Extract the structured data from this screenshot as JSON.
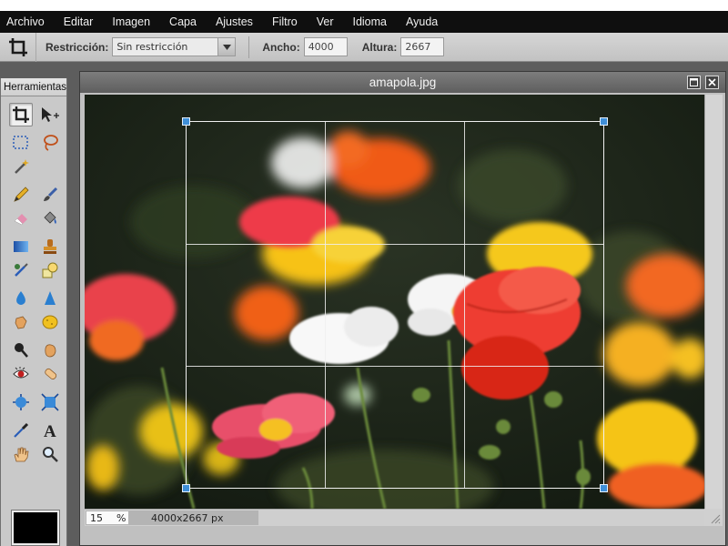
{
  "menubar": {
    "items": [
      "Archivo",
      "Editar",
      "Imagen",
      "Capa",
      "Ajustes",
      "Filtro",
      "Ver",
      "Idioma",
      "Ayuda"
    ]
  },
  "options": {
    "restriction_label": "Restricción:",
    "restriction_value": "Sin restricción",
    "width_label": "Ancho:",
    "width_value": "4000",
    "height_label": "Altura:",
    "height_value": "2667"
  },
  "tools_panel": {
    "title": "Herramientas",
    "primary_color": "#000000",
    "tools": [
      {
        "name": "crop-tool-icon",
        "active": true
      },
      {
        "name": "move-tool-icon"
      },
      {
        "name": "marquee-tool-icon"
      },
      {
        "name": "lasso-tool-icon"
      },
      {
        "name": "magic-wand-tool-icon"
      },
      {
        "name": "pencil-tool-icon"
      },
      {
        "name": "brush-tool-icon"
      },
      {
        "name": "eraser-tool-icon"
      },
      {
        "name": "paint-bucket-tool-icon"
      },
      {
        "name": "gradient-tool-icon"
      },
      {
        "name": "clone-stamp-tool-icon"
      },
      {
        "name": "color-replace-tool-icon"
      },
      {
        "name": "shape-tool-icon"
      },
      {
        "name": "blur-tool-icon"
      },
      {
        "name": "sharpen-tool-icon"
      },
      {
        "name": "smudge-tool-icon"
      },
      {
        "name": "sponge-tool-icon"
      },
      {
        "name": "dodge-tool-icon"
      },
      {
        "name": "burn-tool-icon"
      },
      {
        "name": "red-eye-tool-icon"
      },
      {
        "name": "spot-heal-tool-icon"
      },
      {
        "name": "bloat-tool-icon"
      },
      {
        "name": "pinch-tool-icon"
      },
      {
        "name": "color-picker-tool-icon"
      },
      {
        "name": "text-tool-icon"
      },
      {
        "name": "hand-tool-icon"
      },
      {
        "name": "zoom-tool-icon"
      }
    ]
  },
  "document": {
    "title": "amapola.jpg",
    "zoom": "15",
    "zoom_unit": "%",
    "dimensions": "4000x2667 px"
  },
  "colors": {
    "crop_handle": "#3f8fd8",
    "menubar_bg": "#0f0f0f"
  }
}
